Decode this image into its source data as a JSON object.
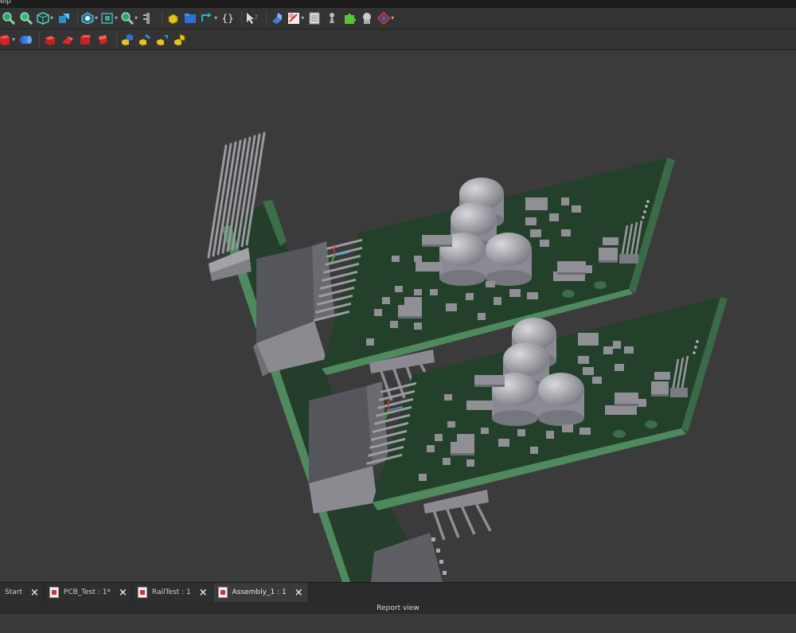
{
  "menubar": {
    "visible_text": "elp"
  },
  "toolbar_top": [
    {
      "icon": "zoom-fit-all-icon"
    },
    {
      "icon": "zoom-fit-selection-icon"
    },
    {
      "icon": "isometric-cube-icon",
      "dropdown": true
    },
    {
      "icon": "cursor-select-icon"
    },
    {
      "icon": "draw-style-icon",
      "dropdown": true
    },
    {
      "icon": "bounding-box-icon",
      "dropdown": true
    },
    {
      "icon": "zoom-icon",
      "dropdown": true
    },
    {
      "icon": "measure-icon"
    },
    {
      "icon": "create-part-icon"
    },
    {
      "icon": "create-group-icon"
    },
    {
      "icon": "link-icon",
      "dropdown": true
    },
    {
      "icon": "macro-braces-icon"
    },
    {
      "icon": "whats-this-help-icon"
    },
    {
      "icon": "part-design-icon"
    },
    {
      "icon": "sketch-icon",
      "dropdown": true
    },
    {
      "icon": "spreadsheet-icon"
    },
    {
      "icon": "chess-pawn-icon"
    },
    {
      "icon": "puzzle-piece-icon"
    },
    {
      "icon": "robot-arm-icon"
    },
    {
      "icon": "workbench-diamond-icon",
      "dropdown": true
    }
  ],
  "toolbar_second": [
    {
      "icon": "red-cube-icon",
      "dropdown": true
    },
    {
      "icon": "blue-cylinder-icon"
    },
    {
      "icon": "red-box-icon"
    },
    {
      "icon": "red-wedge-icon"
    },
    {
      "icon": "red-block-icon"
    },
    {
      "icon": "red-block-front-icon"
    },
    {
      "icon": "assembly-constraint-icon"
    },
    {
      "icon": "assembly-insert-icon"
    },
    {
      "icon": "assembly-move-icon"
    },
    {
      "icon": "assembly-solve-icon"
    }
  ],
  "tabs": [
    {
      "label": "Start",
      "active": false,
      "has_icon": false
    },
    {
      "label": "PCB_Test : 1*",
      "active": false,
      "has_icon": true
    },
    {
      "label": "RailTest : 1",
      "active": false,
      "has_icon": true
    },
    {
      "label": "Assembly_1 : 1",
      "active": true,
      "has_icon": true
    }
  ],
  "tab_close_glyph": "×",
  "report_view": {
    "title": "Report view"
  },
  "colors": {
    "viewport_bg": "#3b3b3b",
    "pcb_green": "#22402a",
    "pcb_edge": "#4f8a5e",
    "component_gray": "#8f8f95",
    "capacitor": "#b0b0b6"
  }
}
